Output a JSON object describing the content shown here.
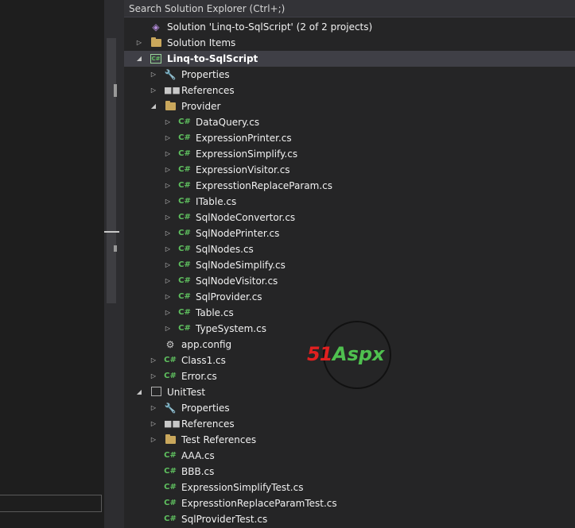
{
  "search": {
    "placeholder": "Search Solution Explorer (Ctrl+;)"
  },
  "watermark": {
    "brand_51": "51",
    "brand_aspx": "Aspx"
  },
  "tree": [
    {
      "name": "solution-node",
      "label": "Solution 'Linq-to-SqlScript' (2 of 2 projects)",
      "icon": "solution-icon",
      "level": 0,
      "expander": "none"
    },
    {
      "name": "tree-item-solution-items",
      "label": "Solution Items",
      "icon": "folder-icon",
      "level": 0,
      "expander": "collapsed"
    },
    {
      "name": "tree-item-linq-to-sqlscript-project",
      "label": "Linq-to-SqlScript",
      "icon": "csharp-project-icon",
      "level": 0,
      "expander": "expanded",
      "selected": true
    },
    {
      "name": "tree-item-properties",
      "label": "Properties",
      "icon": "wrench-icon",
      "level": 1,
      "expander": "collapsed"
    },
    {
      "name": "tree-item-references",
      "label": "References",
      "icon": "references-icon",
      "level": 1,
      "expander": "collapsed"
    },
    {
      "name": "tree-item-provider-folder",
      "label": "Provider",
      "icon": "folder-icon",
      "level": 1,
      "expander": "expanded"
    },
    {
      "name": "tree-item-dataquery",
      "label": "DataQuery.cs",
      "icon": "csharp-file-icon",
      "level": 2,
      "expander": "collapsed"
    },
    {
      "name": "tree-item-expressionprinter",
      "label": "ExpressionPrinter.cs",
      "icon": "csharp-file-icon",
      "level": 2,
      "expander": "collapsed"
    },
    {
      "name": "tree-item-expressionsimplify",
      "label": "ExpressionSimplify.cs",
      "icon": "csharp-file-icon",
      "level": 2,
      "expander": "collapsed"
    },
    {
      "name": "tree-item-expressionvisitor",
      "label": "ExpressionVisitor.cs",
      "icon": "csharp-file-icon",
      "level": 2,
      "expander": "collapsed"
    },
    {
      "name": "tree-item-expresstionreplaceparam",
      "label": "ExpresstionReplaceParam.cs",
      "icon": "csharp-file-icon",
      "level": 2,
      "expander": "collapsed"
    },
    {
      "name": "tree-item-itable",
      "label": "ITable.cs",
      "icon": "csharp-file-icon",
      "level": 2,
      "expander": "collapsed"
    },
    {
      "name": "tree-item-sqlnodeconvertor",
      "label": "SqlNodeConvertor.cs",
      "icon": "csharp-file-icon",
      "level": 2,
      "expander": "collapsed"
    },
    {
      "name": "tree-item-sqlnodeprinter",
      "label": "SqlNodePrinter.cs",
      "icon": "csharp-file-icon",
      "level": 2,
      "expander": "collapsed"
    },
    {
      "name": "tree-item-sqlnodes",
      "label": "SqlNodes.cs",
      "icon": "csharp-file-icon",
      "level": 2,
      "expander": "collapsed"
    },
    {
      "name": "tree-item-sqlnodesimplify",
      "label": "SqlNodeSimplify.cs",
      "icon": "csharp-file-icon",
      "level": 2,
      "expander": "collapsed"
    },
    {
      "name": "tree-item-sqlnodevisitor",
      "label": "SqlNodeVisitor.cs",
      "icon": "csharp-file-icon",
      "level": 2,
      "expander": "collapsed"
    },
    {
      "name": "tree-item-sqlprovider",
      "label": "SqlProvider.cs",
      "icon": "csharp-file-icon",
      "level": 2,
      "expander": "collapsed"
    },
    {
      "name": "tree-item-table",
      "label": "Table.cs",
      "icon": "csharp-file-icon",
      "level": 2,
      "expander": "collapsed"
    },
    {
      "name": "tree-item-typesystem",
      "label": "TypeSystem.cs",
      "icon": "csharp-file-icon",
      "level": 2,
      "expander": "collapsed"
    },
    {
      "name": "tree-item-app-config",
      "label": "app.config",
      "icon": "config-file-icon",
      "level": 1,
      "expander": "none"
    },
    {
      "name": "tree-item-class1",
      "label": "Class1.cs",
      "icon": "csharp-file-icon",
      "level": 1,
      "expander": "collapsed"
    },
    {
      "name": "tree-item-error",
      "label": "Error.cs",
      "icon": "csharp-file-icon",
      "level": 1,
      "expander": "collapsed"
    },
    {
      "name": "tree-item-unittest-project",
      "label": "UnitTest",
      "icon": "test-project-icon",
      "level": 0,
      "expander": "expanded"
    },
    {
      "name": "tree-item-unittest-properties",
      "label": "Properties",
      "icon": "wrench-icon",
      "level": 1,
      "expander": "collapsed"
    },
    {
      "name": "tree-item-unittest-references",
      "label": "References",
      "icon": "references-icon",
      "level": 1,
      "expander": "collapsed"
    },
    {
      "name": "tree-item-test-references",
      "label": "Test References",
      "icon": "folder-icon",
      "level": 1,
      "expander": "collapsed"
    },
    {
      "name": "tree-item-aaa",
      "label": "AAA.cs",
      "icon": "csharp-file-icon",
      "level": 1,
      "expander": "none"
    },
    {
      "name": "tree-item-bbb",
      "label": "BBB.cs",
      "icon": "csharp-file-icon",
      "level": 1,
      "expander": "none"
    },
    {
      "name": "tree-item-expressionsimplifytest",
      "label": "ExpressionSimplifyTest.cs",
      "icon": "csharp-file-icon",
      "level": 1,
      "expander": "none"
    },
    {
      "name": "tree-item-expresstionreplaceparamtest",
      "label": "ExpresstionReplaceParamTest.cs",
      "icon": "csharp-file-icon",
      "level": 1,
      "expander": "none"
    },
    {
      "name": "tree-item-sqlprovidertest",
      "label": "SqlProviderTest.cs",
      "icon": "csharp-file-icon",
      "level": 1,
      "expander": "none"
    }
  ]
}
